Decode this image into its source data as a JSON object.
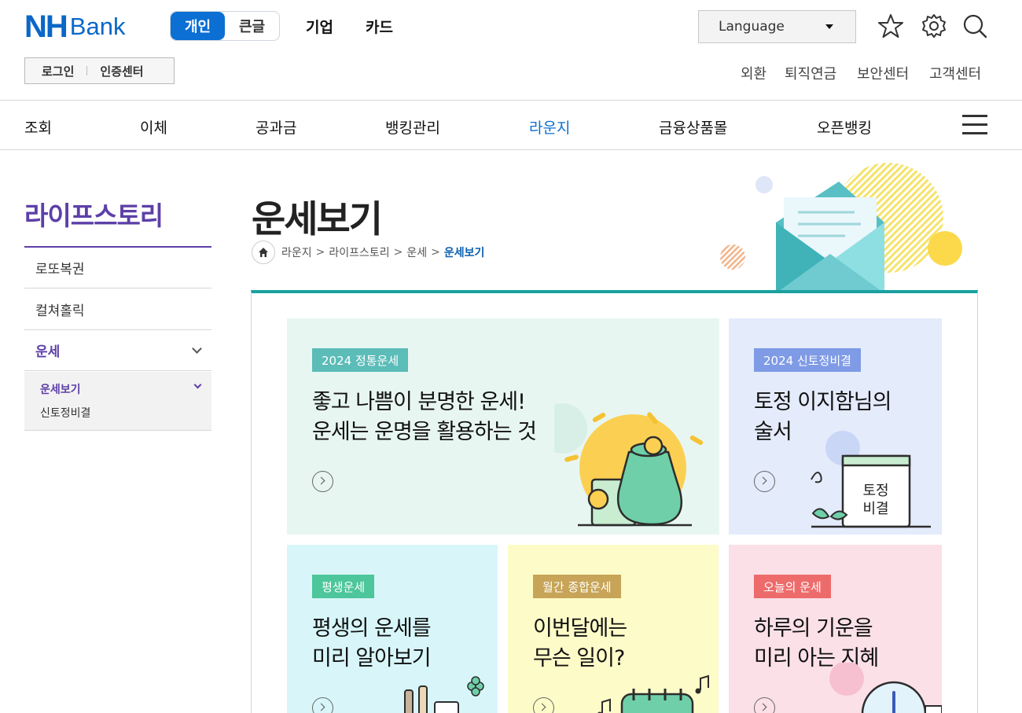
{
  "header": {
    "logo": {
      "nh": "NH",
      "bank": "Bank"
    },
    "mode_toggle": [
      "개인",
      "큰글"
    ],
    "top_links": [
      "기업",
      "카드"
    ],
    "language": "Language",
    "login": "로그인",
    "cert_center": "인증센터",
    "util_links": [
      "외환",
      "퇴직연금",
      "보안센터",
      "고객센터"
    ]
  },
  "gnb": {
    "items": [
      "조회",
      "이체",
      "공과금",
      "뱅킹관리",
      "라운지",
      "금융상품몰",
      "오픈뱅킹"
    ],
    "active": "라운지"
  },
  "lnb": {
    "title": "라이프스토리",
    "items": [
      "로또복권",
      "컬쳐홀릭",
      "운세"
    ],
    "sub_items": [
      "운세보기",
      "신토정비결"
    ]
  },
  "page": {
    "title": "운세보기",
    "breadcrumb": [
      "라운지",
      "라이프스토리",
      "운세",
      "운세보기"
    ]
  },
  "cards": [
    {
      "tag": "2024 정통운세",
      "line1": "좋고 나쁨이 분명한 운세!",
      "line2": "운세는 운명을 활용하는 것",
      "bg": "#e8f6f2",
      "tag_color": "#5bbcb8"
    },
    {
      "tag": "2024 신토정비결",
      "line1": "토정 이지함님의",
      "line2": "술서",
      "bg": "#e4ebfb",
      "tag_color": "#7f9be6",
      "art_text1": "토정",
      "art_text2": "비결"
    },
    {
      "tag": "평생운세",
      "line1": "평생의 운세를",
      "line2": "미리 알아보기",
      "bg": "#d8f6f9",
      "tag_color": "#4cc69a"
    },
    {
      "tag": "월간 종합운세",
      "line1": "이번달에는",
      "line2": "무슨 일이?",
      "bg": "#fdfbc8",
      "tag_color": "#c7a457"
    },
    {
      "tag": "오늘의 운세",
      "line1": "하루의 기운을",
      "line2": "미리 아는 지혜",
      "bg": "#fbe0e8",
      "tag_color": "#ee6b6b"
    }
  ],
  "colors": {
    "brand": "#0a67c8",
    "purple": "#5d3fa8",
    "teal": "#1aa0a0"
  }
}
